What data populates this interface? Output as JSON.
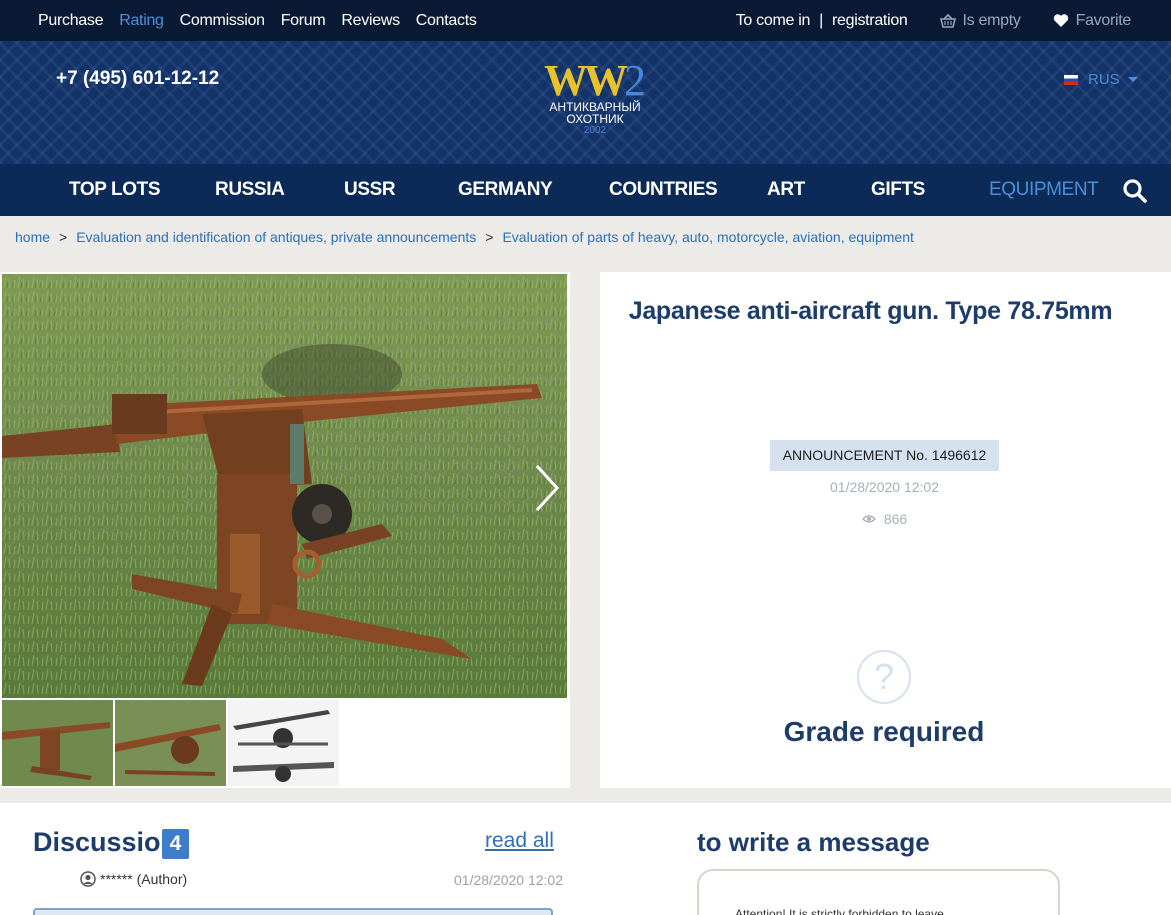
{
  "topbar": {
    "links": [
      "Purchase",
      "Rating",
      "Commission",
      "Forum",
      "Reviews",
      "Contacts"
    ],
    "login": "To come in",
    "separator": "|",
    "register": "registration",
    "cart": "Is empty",
    "favorite": "Favorite"
  },
  "header": {
    "phone": "+7 (495) 601-12-12",
    "logo_ww": "WW",
    "logo_num": "2",
    "logo_line1": "АНТИКВАРНЫЙ",
    "logo_line2": "ОХОТНИК",
    "logo_year": "2002",
    "language": "RUS"
  },
  "mainnav": {
    "items": [
      "TOP LOTS",
      "RUSSIA",
      "USSR",
      "GERMANY",
      "COUNTRIES",
      "ART",
      "GIFTS",
      "EQUIPMENT"
    ]
  },
  "breadcrumb": {
    "items": [
      "home",
      "Evaluation and identification of antiques, private announcements",
      "Evaluation of parts of heavy, auto, motorcycle, aviation, equipment"
    ],
    "separator": ">"
  },
  "lot": {
    "title": "Japanese anti-aircraft gun. Type 78.75mm",
    "announcement": "ANNOUNCEMENT No. 1496612",
    "date": "01/28/2020 12:02",
    "views": "866",
    "grade_status": "Grade required"
  },
  "discussion": {
    "title": "Discussion",
    "count": "4",
    "read_all": "read all",
    "author": "****** (Author)",
    "date": "01/28/2020 12:02"
  },
  "write": {
    "title": "to write a message",
    "note": "Attention! It is strictly forbidden to leave..."
  },
  "colors": {
    "accent": "#4c8fd9",
    "nav_bg": "#0b2a57",
    "topbar_bg": "#0b1a34",
    "title_text": "#1d3c69",
    "badge_bg": "#d5e1ef"
  }
}
